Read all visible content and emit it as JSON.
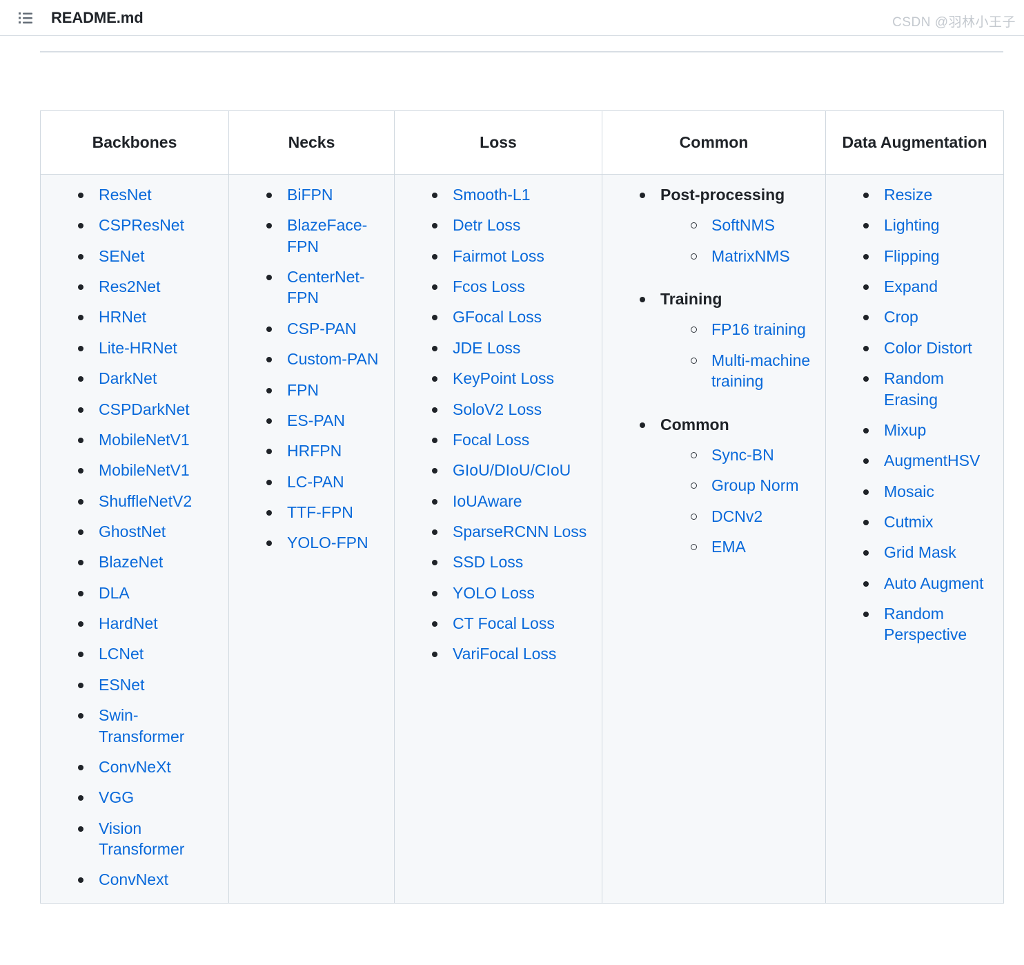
{
  "header": {
    "file_name": "README.md",
    "list_icon": "unordered-list-icon"
  },
  "colors": {
    "link": "#0969da",
    "text": "#1f2328",
    "border": "#d1d9e0",
    "row_bg": "#f6f8fa",
    "header_bg": "#ffffff"
  },
  "table": {
    "columns": [
      {
        "header": "Backbones"
      },
      {
        "header": "Necks"
      },
      {
        "header": "Loss"
      },
      {
        "header": "Common"
      },
      {
        "header": "Data Augmentation"
      }
    ],
    "backbones": [
      "ResNet",
      "CSPResNet",
      "SENet",
      "Res2Net",
      "HRNet",
      "Lite-HRNet",
      "DarkNet",
      "CSPDarkNet",
      "MobileNetV1",
      "MobileNetV1",
      "ShuffleNetV2",
      "GhostNet",
      "BlazeNet",
      "DLA",
      "HardNet",
      "LCNet",
      "ESNet",
      "Swin-Transformer",
      "ConvNeXt",
      "VGG",
      "Vision Transformer",
      "ConvNext"
    ],
    "necks": [
      "BiFPN",
      "BlazeFace-FPN",
      "CenterNet-FPN",
      "CSP-PAN",
      "Custom-PAN",
      "FPN",
      "ES-PAN",
      "HRFPN",
      "LC-PAN",
      "TTF-FPN",
      "YOLO-FPN"
    ],
    "loss": [
      "Smooth-L1",
      "Detr Loss",
      "Fairmot Loss",
      "Fcos Loss",
      "GFocal Loss",
      "JDE Loss",
      "KeyPoint Loss",
      "SoloV2 Loss",
      "Focal Loss",
      "GIoU/DIoU/CIoU",
      "IoUAware",
      "SparseRCNN Loss",
      "SSD Loss",
      "YOLO Loss",
      "CT Focal Loss",
      "VariFocal Loss"
    ],
    "common": [
      {
        "label": "Post-processing",
        "items": [
          "SoftNMS",
          "MatrixNMS"
        ]
      },
      {
        "label": "Training",
        "items": [
          "FP16 training",
          "Multi-machine training"
        ]
      },
      {
        "label": "Common",
        "items": [
          "Sync-BN",
          "Group Norm",
          "DCNv2",
          "EMA"
        ]
      }
    ],
    "data_augmentation": [
      "Resize",
      "Lighting",
      "Flipping",
      "Expand",
      "Crop",
      "Color Distort",
      "Random Erasing",
      "Mixup",
      "AugmentHSV",
      "Mosaic",
      "Cutmix",
      "Grid Mask",
      "Auto Augment",
      "Random Perspective"
    ]
  },
  "watermark": "CSDN @羽林小王子"
}
